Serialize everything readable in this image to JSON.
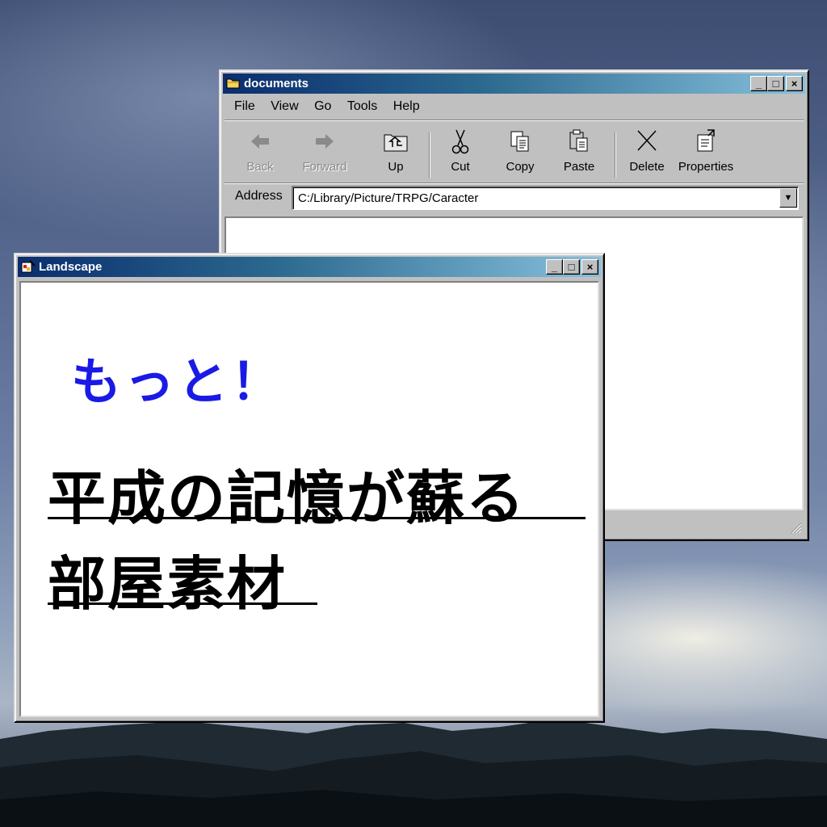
{
  "desktop": {
    "wallpaper": "cloudy-sky-over-mountains"
  },
  "explorer": {
    "title": "documents",
    "icon": "folder-icon",
    "menu": [
      "File",
      "View",
      "Go",
      "Tools",
      "Help"
    ],
    "toolbar": [
      {
        "label": "Back",
        "icon": "back-arrow-icon",
        "enabled": false
      },
      {
        "label": "Forward",
        "icon": "forward-arrow-icon",
        "enabled": false
      },
      {
        "label": "Up",
        "icon": "up-folder-icon",
        "enabled": true
      },
      {
        "label": "Cut",
        "icon": "scissors-icon",
        "enabled": true
      },
      {
        "label": "Copy",
        "icon": "copy-icon",
        "enabled": true
      },
      {
        "label": "Paste",
        "icon": "paste-icon",
        "enabled": true
      },
      {
        "label": "Delete",
        "icon": "delete-x-icon",
        "enabled": true
      },
      {
        "label": "Properties",
        "icon": "properties-icon",
        "enabled": true
      }
    ],
    "address_label": "Address",
    "address_value": "C:/Library/Picture/TRPG/Caracter"
  },
  "landscape": {
    "title": "Landscape",
    "icon": "paint-icon",
    "text_blue": "もっと！",
    "text_line1": "平成の記憶が蘇る",
    "text_line2": "部屋素材",
    "colors": {
      "blue_text": "#1a1ae6",
      "black_text": "#000000"
    }
  },
  "window_buttons": {
    "minimize": "_",
    "maximize": "□",
    "close": "×"
  }
}
